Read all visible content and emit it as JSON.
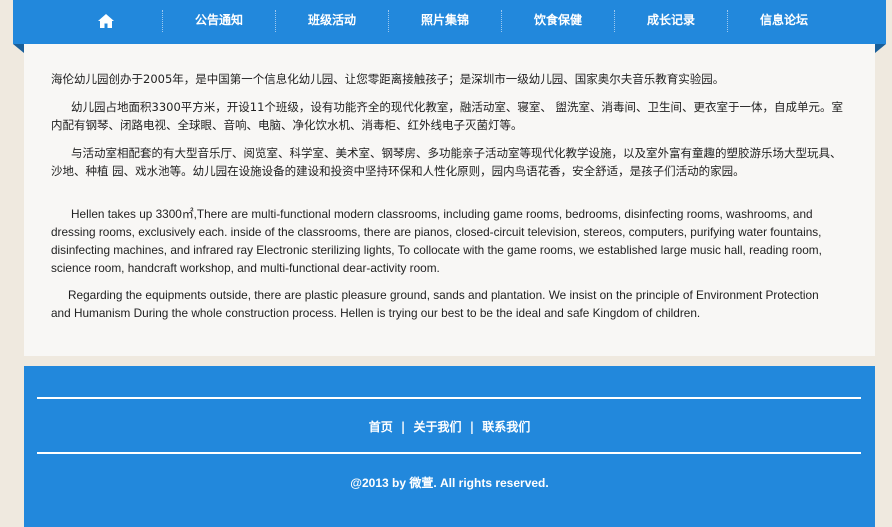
{
  "nav": {
    "home_icon": "home-icon",
    "items": [
      "公告通知",
      "班级活动",
      "照片集锦",
      "饮食保健",
      "成长记录",
      "信息论坛"
    ]
  },
  "content": {
    "paragraphs": [
      "海伦幼儿园创办于2005年，是中国第一个信息化幼儿园、让您零距离接触孩子；是深圳市一级幼儿园、国家奥尔夫音乐教育实验园。",
      "幼儿园占地面积3300平方米，开设11个班级，设有功能齐全的现代化教室，融活动室、寝室、 盥洗室、消毒间、卫生间、更衣室于一体，自成单元。室内配有钢琴、闭路电视、全球眼、音响、电脑、净化饮水机、消毒柜、红外线电子灭菌灯等。",
      "与活动室相配套的有大型音乐厅、阅览室、科学室、美术室、钢琴房、多功能亲子活动室等现代化教学设施，以及室外富有童趣的塑胶游乐场大型玩具、沙地、种植 园、戏水池等。幼儿园在设施设备的建设和投资中坚持环保和人性化原则，园内鸟语花香，安全舒适，是孩子们活动的家园。",
      "Hellen takes up 3300㎡,There are multi-functional modern classrooms, including game rooms, bedrooms, disinfecting rooms, washrooms, and dressing rooms, exclusively each. inside of the classrooms, there are pianos, closed-circuit television, stereos, computers, purifying water fountains, disinfecting machines, and infrared ray Electronic sterilizing lights, To collocate with the game rooms, we established large music hall, reading room, science room, handcraft workshop, and multi-functional dear-activity room.",
      "Regarding the equipments outside, there are plastic pleasure ground, sands and plantation. We insist on the principle of Environment Protection and Humanism During the whole construction process. Hellen is trying our best to be the ideal and safe Kingdom of children."
    ]
  },
  "footer": {
    "links": [
      "首页",
      "关于我们",
      "联系我们"
    ],
    "separator": "|",
    "copyright": "@2013 by 微萱. All rights reserved."
  },
  "colors": {
    "accent": "#2288dc",
    "background": "#efe9df",
    "content_bg": "#f8f7f5"
  }
}
